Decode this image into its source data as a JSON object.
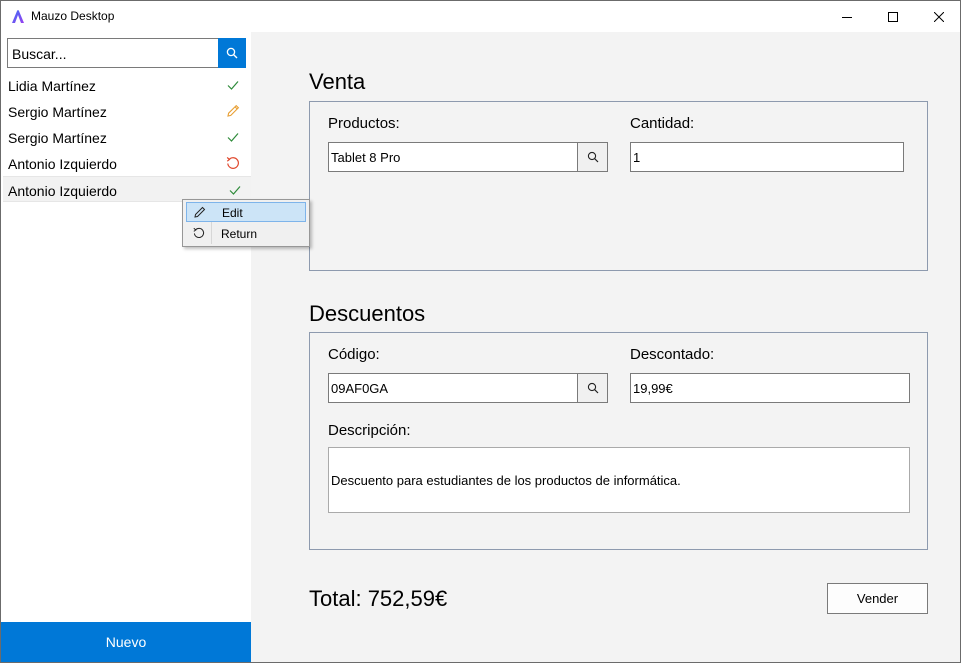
{
  "window": {
    "title": "Mauzo Desktop"
  },
  "sidebar": {
    "search_placeholder": "Buscar...",
    "items": [
      {
        "name": "Lidia Martínez",
        "status": "check-icon"
      },
      {
        "name": "Sergio Martínez",
        "status": "pencil-icon"
      },
      {
        "name": "Sergio Martínez",
        "status": "check-icon"
      },
      {
        "name": "Antonio Izquierdo",
        "status": "return-icon"
      },
      {
        "name": "Antonio Izquierdo",
        "status": "check-icon",
        "selected": true
      }
    ],
    "new_label": "Nuevo"
  },
  "context_menu": {
    "items": [
      {
        "label": "Edit",
        "icon": "pencil-icon"
      },
      {
        "label": "Return",
        "icon": "return-icon"
      }
    ]
  },
  "venta": {
    "title": "Venta",
    "productos_label": "Productos:",
    "productos_value": "Tablet 8 Pro",
    "cantidad_label": "Cantidad:",
    "cantidad_value": "1"
  },
  "descuentos": {
    "title": "Descuentos",
    "codigo_label": "Código:",
    "codigo_value": "09AF0GA",
    "descontado_label": "Descontado:",
    "descontado_value": "19,99€",
    "descripcion_label": "Descripción:",
    "descripcion_value": "Descuento para estudiantes de los productos de informática."
  },
  "footer": {
    "total": "Total: 752,59€",
    "sell_label": "Vender"
  },
  "colors": {
    "accent": "#0078d7",
    "check": "#2e8b3a",
    "pencil": "#e8a035",
    "return": "#e0472c"
  }
}
